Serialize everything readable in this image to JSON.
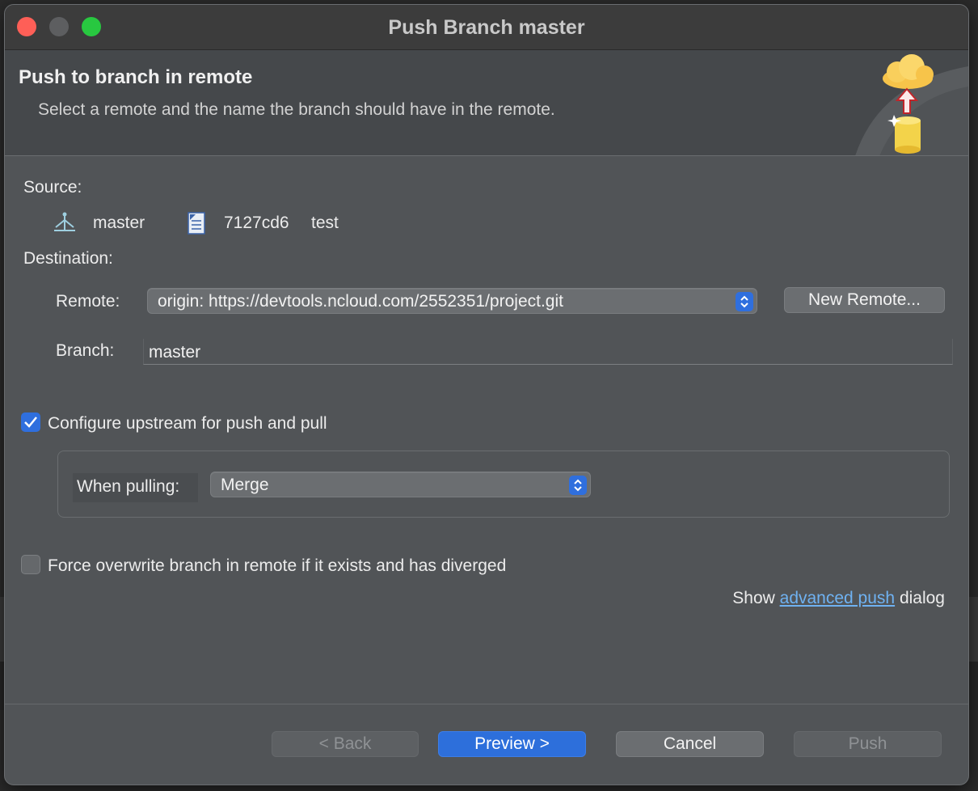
{
  "window": {
    "title": "Push Branch master"
  },
  "header": {
    "title": "Push to branch in remote",
    "description": "Select a remote and the name the branch should have in the remote."
  },
  "source": {
    "label": "Source:",
    "branch": "master",
    "commit_id": "7127cd6",
    "commit_message": "test"
  },
  "destination": {
    "label": "Destination:",
    "remote_label": "Remote:",
    "remote_value": "origin: https://devtools.ncloud.com/2552351/project.git",
    "new_remote_button": "New Remote...",
    "branch_label": "Branch:",
    "branch_value": "master"
  },
  "upstream": {
    "checkbox_label": "Configure upstream for push and pull",
    "checked": true,
    "pulling_label": "When pulling:",
    "pulling_value": "Merge"
  },
  "force": {
    "checkbox_label": "Force overwrite branch in remote if it exists and has diverged",
    "checked": false
  },
  "advanced": {
    "prefix": "Show",
    "link": "advanced push",
    "suffix": "dialog"
  },
  "buttons": {
    "back": "< Back",
    "preview": "Preview >",
    "cancel": "Cancel",
    "push": "Push"
  },
  "colors": {
    "accent": "#2d6fdb",
    "link": "#6fb2f2",
    "close": "#fe5f57",
    "maximize": "#28c840"
  }
}
